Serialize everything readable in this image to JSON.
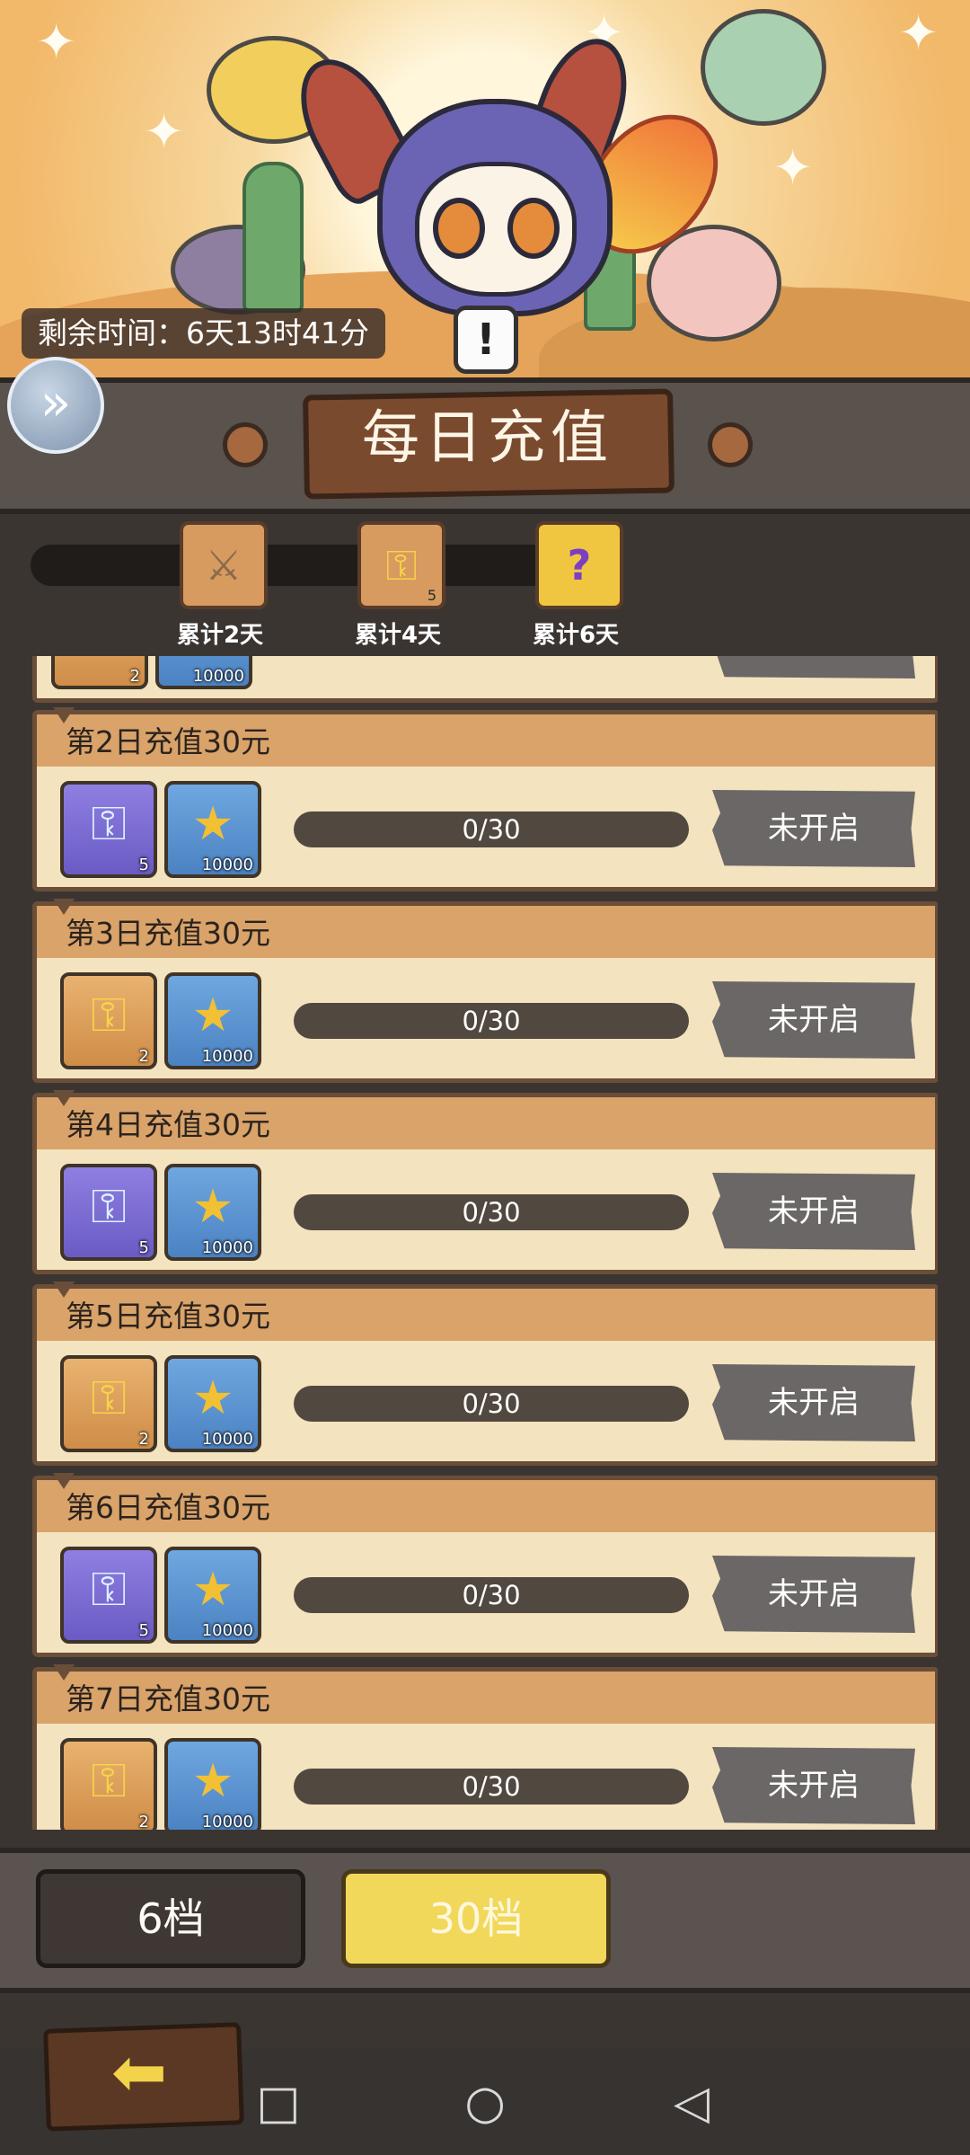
{
  "header": {
    "remaining_time": "剩余时间：6天13时41分",
    "info_icon": "!",
    "expand_icon": "»"
  },
  "title": "每日充值",
  "milestones": [
    {
      "label": "累计2天",
      "icon": "sword-scroll-icon",
      "qty": ""
    },
    {
      "label": "累计4天",
      "icon": "gold-key-icon",
      "qty": "5"
    },
    {
      "label": "累计6天",
      "icon": "mystery-chest-icon",
      "qty": ""
    }
  ],
  "partial_card": {
    "items": [
      {
        "type": "gold-key",
        "qty": "2"
      },
      {
        "type": "coin",
        "qty": "10000"
      }
    ]
  },
  "days": [
    {
      "title": "第2日充值30元",
      "items": [
        {
          "type": "blue-key",
          "qty": "5"
        },
        {
          "type": "coin",
          "qty": "10000"
        }
      ],
      "progress": "0/30",
      "status": "未开启"
    },
    {
      "title": "第3日充值30元",
      "items": [
        {
          "type": "gold-key",
          "qty": "2"
        },
        {
          "type": "coin",
          "qty": "10000"
        }
      ],
      "progress": "0/30",
      "status": "未开启"
    },
    {
      "title": "第4日充值30元",
      "items": [
        {
          "type": "blue-key",
          "qty": "5"
        },
        {
          "type": "coin",
          "qty": "10000"
        }
      ],
      "progress": "0/30",
      "status": "未开启"
    },
    {
      "title": "第5日充值30元",
      "items": [
        {
          "type": "gold-key",
          "qty": "2"
        },
        {
          "type": "coin",
          "qty": "10000"
        }
      ],
      "progress": "0/30",
      "status": "未开启"
    },
    {
      "title": "第6日充值30元",
      "items": [
        {
          "type": "blue-key",
          "qty": "5"
        },
        {
          "type": "coin",
          "qty": "10000"
        }
      ],
      "progress": "0/30",
      "status": "未开启"
    },
    {
      "title": "第7日充值30元",
      "items": [
        {
          "type": "gold-key",
          "qty": "2"
        },
        {
          "type": "coin",
          "qty": "10000"
        }
      ],
      "progress": "0/30",
      "status": "未开启"
    }
  ],
  "tiers": {
    "tier_6": "6档",
    "tier_30": "30档",
    "selected": "30档"
  },
  "colors": {
    "accent_yellow": "#f2d85a",
    "card_bg": "#f3e3bf",
    "card_head": "#d9a36a",
    "locked_button": "#6a6766"
  },
  "icons": {
    "key_glyph": "⚿",
    "coin_glyph": "★",
    "back_glyph": "⬅",
    "nav_recent": "□",
    "nav_home": "○",
    "nav_back": "◁"
  }
}
